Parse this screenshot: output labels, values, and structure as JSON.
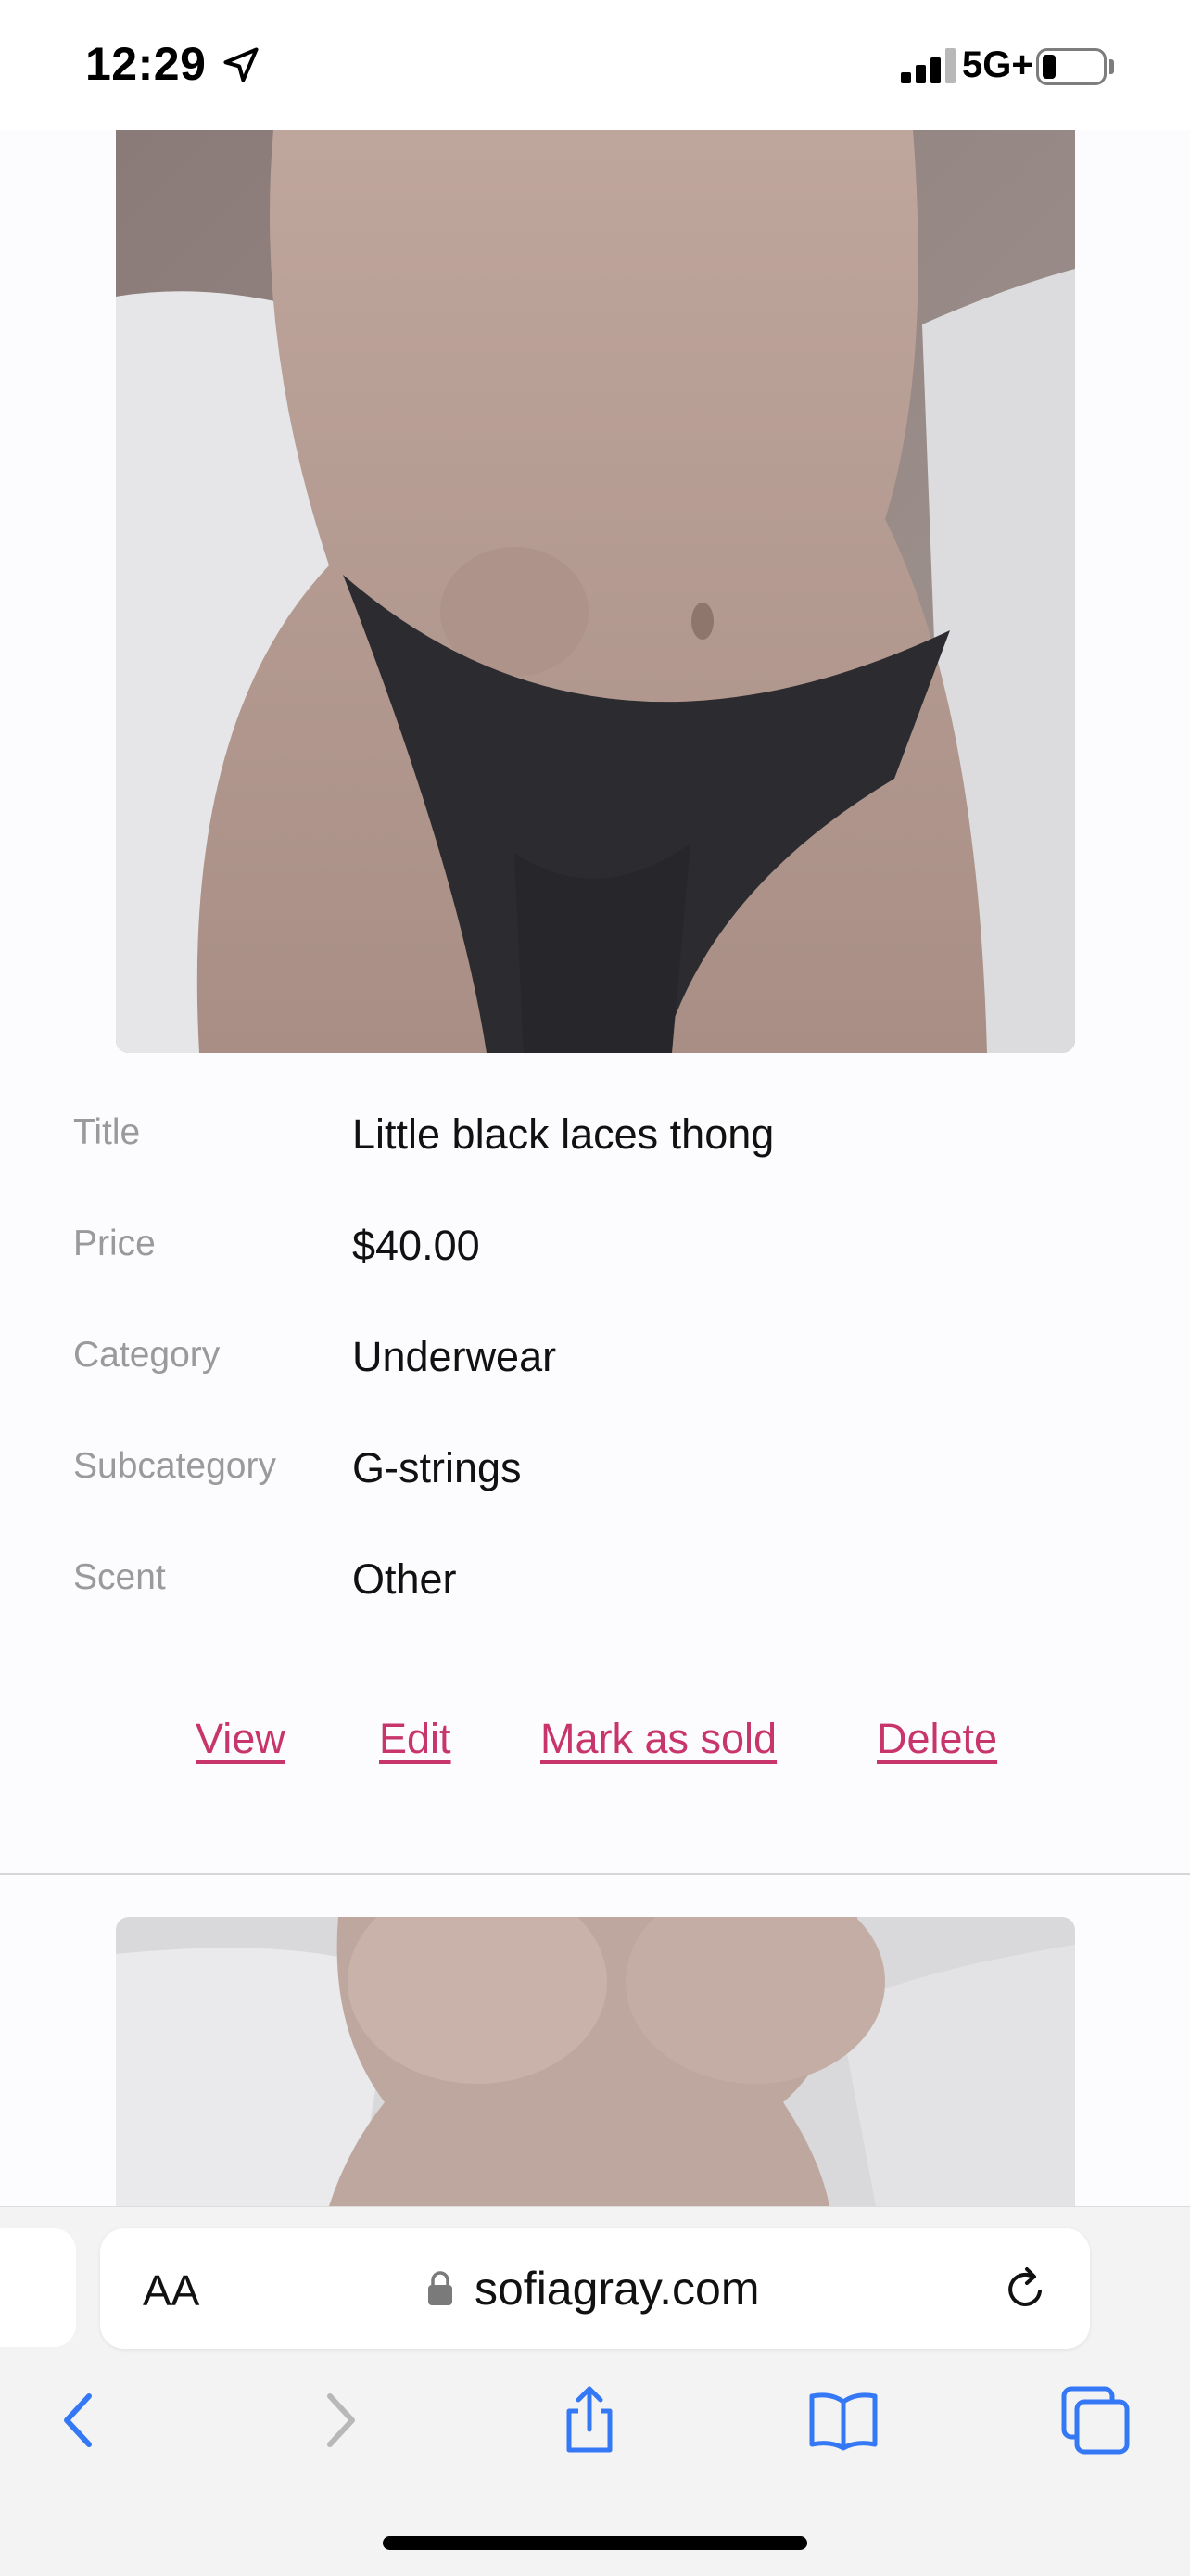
{
  "status_bar": {
    "time": "12:29",
    "network": "5G+",
    "icons": [
      "location-arrow-icon",
      "signal-bars-icon",
      "battery-icon"
    ]
  },
  "listing": {
    "photo_alt": "Listing photo",
    "fields": [
      {
        "label": "Title",
        "value": "Little black laces thong"
      },
      {
        "label": "Price",
        "value": "$40.00"
      },
      {
        "label": "Category",
        "value": "Underwear"
      },
      {
        "label": "Subcategory",
        "value": "G-strings"
      },
      {
        "label": "Scent",
        "value": "Other"
      }
    ],
    "actions": {
      "view": "View",
      "edit": "Edit",
      "mark_as_sold": "Mark as sold",
      "delete": "Delete"
    }
  },
  "browser": {
    "text_size_label": "AA",
    "url": "sofiagray.com",
    "icons": [
      "lock-icon",
      "reload-icon",
      "back-icon",
      "forward-icon",
      "share-icon",
      "bookmarks-icon",
      "tabs-icon"
    ]
  },
  "colors": {
    "action_link": "#c8356a",
    "ios_blue": "#3478f6"
  }
}
